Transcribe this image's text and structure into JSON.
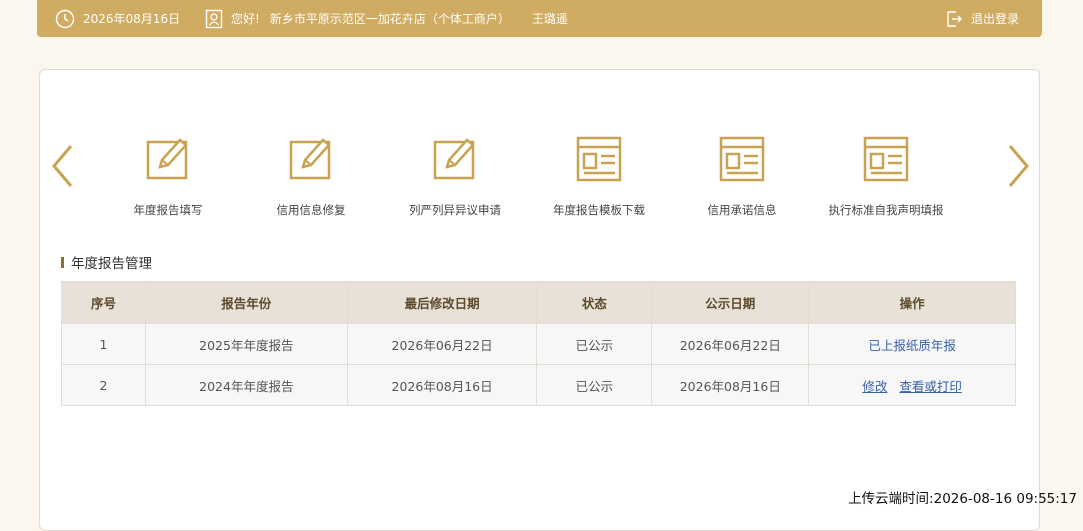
{
  "header": {
    "date": "2026年08月16日",
    "greeting": "您好!",
    "company": "新乡市平原示范区一加花卉店（个体工商户）",
    "user": "王璐遥",
    "logout": "退出登录"
  },
  "features": [
    {
      "label": "年度报告填写",
      "icon": "edit-icon"
    },
    {
      "label": "信用信息修复",
      "icon": "edit-icon"
    },
    {
      "label": "列严列异异议申请",
      "icon": "edit-icon"
    },
    {
      "label": "年度报告模板下载",
      "icon": "document-icon"
    },
    {
      "label": "信用承诺信息",
      "icon": "document-icon"
    },
    {
      "label": "执行标准自我声明填报",
      "icon": "document-icon"
    }
  ],
  "section": {
    "title": "年度报告管理"
  },
  "table": {
    "headers": [
      "序号",
      "报告年份",
      "最后修改日期",
      "状态",
      "公示日期",
      "操作"
    ],
    "rows": [
      {
        "no": "1",
        "year": "2025年年度报告",
        "modified": "2026年06月22日",
        "status": "已公示",
        "published": "2026年06月22日",
        "actions": [
          "已上报纸质年报"
        ]
      },
      {
        "no": "2",
        "year": "2024年年度报告",
        "modified": "2026年08月16日",
        "status": "已公示",
        "published": "2026年08月16日",
        "actions": [
          "修改",
          "查看或打印"
        ]
      }
    ]
  },
  "footer": {
    "upload_time": "上传云端时间:2026-08-16 09:55:17"
  },
  "colors": {
    "accent": "#d0ab62",
    "icon": "#c8a352",
    "link": "#3a62a8"
  }
}
